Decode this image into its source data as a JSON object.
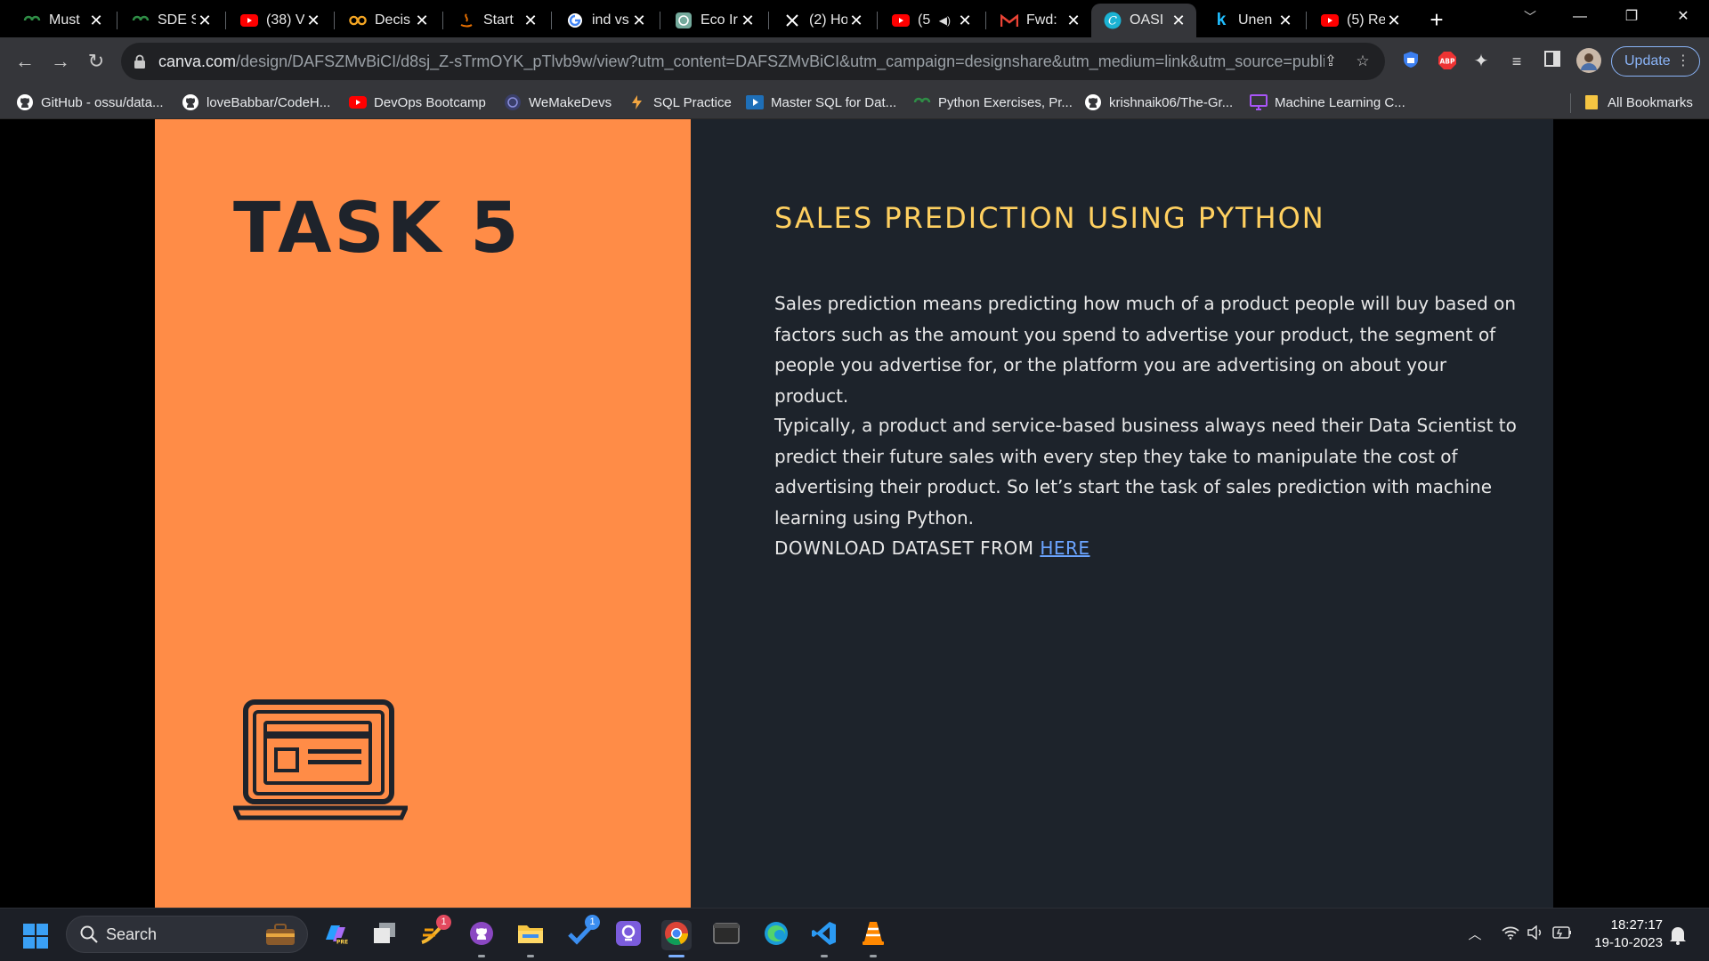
{
  "tabs": [
    {
      "title": "Must",
      "icon": "geeksforgeeks-icon"
    },
    {
      "title": "SDE S",
      "icon": "geeksforgeeks-icon"
    },
    {
      "title": "(38) V",
      "icon": "youtube-icon"
    },
    {
      "title": "Decis",
      "icon": "coursera-icon"
    },
    {
      "title": "Start",
      "icon": "java-icon"
    },
    {
      "title": "ind vs",
      "icon": "google-icon"
    },
    {
      "title": "Eco Ir",
      "icon": "chatgpt-icon"
    },
    {
      "title": "(2) Ho",
      "icon": "x-icon"
    },
    {
      "title": "(5",
      "icon": "youtube-icon"
    },
    {
      "title": "Fwd:",
      "icon": "gmail-icon"
    },
    {
      "title": "OASI",
      "icon": "canva-icon"
    },
    {
      "title": "Unen",
      "icon": "kaggle-icon"
    },
    {
      "title": "(5) Re",
      "icon": "youtube-icon"
    }
  ],
  "toolbar": {
    "url_host": "canva.com",
    "url_path": "/design/DAFSZMvBiCI/d8sj_Z-sTrmOYK_pTlvb9w/view?utm_content=DAFSZMvBiCI&utm_campaign=designshare&utm_medium=link&utm_source=publish...",
    "update_label": "Update",
    "abp_label": "ABP"
  },
  "bookmarks": [
    {
      "label": "GitHub - ossu/data...",
      "icon": "github-icon"
    },
    {
      "label": "loveBabbar/CodeH...",
      "icon": "github-icon"
    },
    {
      "label": "DevOps Bootcamp",
      "icon": "youtube-icon"
    },
    {
      "label": "WeMakeDevs",
      "icon": "wemakedevs-icon"
    },
    {
      "label": "SQL Practice",
      "icon": "sql-icon"
    },
    {
      "label": "Master SQL for Dat...",
      "icon": "play-icon"
    },
    {
      "label": "Python Exercises, Pr...",
      "icon": "geeksforgeeks-icon"
    },
    {
      "label": "krishnaik06/The-Gr...",
      "icon": "github-icon"
    },
    {
      "label": "Machine Learning C...",
      "icon": "screen-icon"
    }
  ],
  "all_bookmarks_label": "All Bookmarks",
  "slide": {
    "task_title": "TASK 5",
    "heading": "SALES PREDICTION USING PYTHON",
    "paragraph1": "Sales prediction means predicting how much of a product people will buy based on factors such as the amount you spend to advertise your product, the segment of people you advertise for, or the platform you are advertising on about your product.",
    "paragraph2": "Typically, a product and service-based business always need their Data Scientist to predict their future sales with every step they take to manipulate the cost of advertising their product. So let’s start the task of sales prediction with machine learning using Python.",
    "download_text": "DOWNLOAD DATASET FROM ",
    "download_link": "HERE",
    "colors": {
      "left_panel": "#ff8c47",
      "right_panel": "#1d232b",
      "heading": "#ffd060",
      "link": "#6ba4ff"
    }
  },
  "taskbar": {
    "search_label": "Search",
    "notifications_badge_1": "1",
    "notifications_badge_2": "1",
    "time": "18:27:17",
    "date": "19-10-2023"
  }
}
